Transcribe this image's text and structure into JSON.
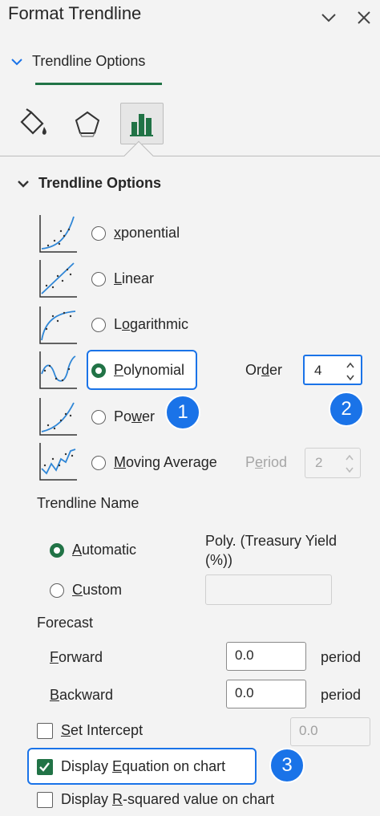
{
  "panel": {
    "title": "Format Trendline",
    "tab_label": "Trendline Options"
  },
  "section": {
    "title": "Trendline Options"
  },
  "types": [
    {
      "label_pre": "",
      "label_u": "x",
      "label_post": "ponential",
      "display": "Exponential"
    },
    {
      "label_pre": "",
      "label_u": "L",
      "label_post": "inear",
      "display": "Linear"
    },
    {
      "label_pre": "L",
      "label_u": "o",
      "label_post": "garithmic",
      "display": "Logarithmic"
    },
    {
      "label_pre": "",
      "label_u": "P",
      "label_post": "olynomial",
      "display": "Polynomial"
    },
    {
      "label_pre": "Po",
      "label_u": "w",
      "label_post": "er",
      "display": "Power"
    },
    {
      "label_pre": "",
      "label_u": "M",
      "label_post": "oving Average",
      "display": "Moving Average"
    }
  ],
  "selected_type": "Polynomial",
  "order": {
    "label": "Order",
    "value": "4"
  },
  "period": {
    "label": "Period",
    "value": "2"
  },
  "badges": [
    "1",
    "2",
    "3"
  ],
  "trendline_name": {
    "label": "Trendline Name",
    "automatic": "Automatic",
    "custom": "Custom",
    "auto_value": "Poly. (Treasury Yield (%))",
    "custom_value": ""
  },
  "forecast": {
    "label": "Forecast",
    "forward_label": "Forward",
    "forward_value": "0.0",
    "backward_label": "Backward",
    "backward_value": "0.0",
    "unit": "period"
  },
  "set_intercept": {
    "label": "Set Intercept",
    "value": "0.0",
    "checked": false
  },
  "display_equation": {
    "label": "Display Equation on chart",
    "checked": true
  },
  "display_rsquared": {
    "label": "Display R-squared value on chart",
    "checked": false
  },
  "colors": {
    "accent": "#217346",
    "highlight": "#1a73e8",
    "curve": "#2f86d6"
  }
}
